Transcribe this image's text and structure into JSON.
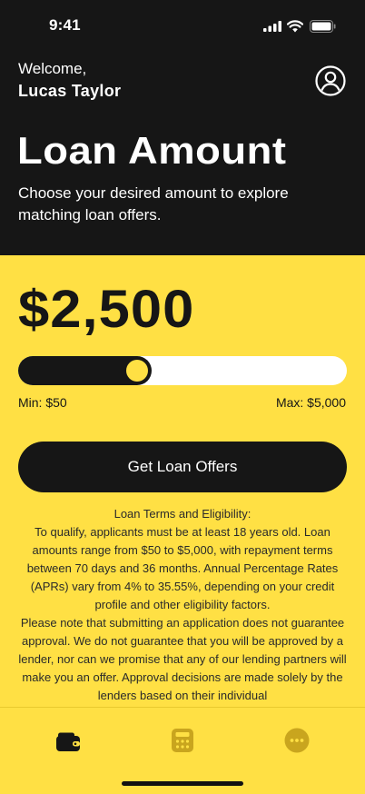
{
  "status_bar": {
    "time": "9:41"
  },
  "header": {
    "greeting": "Welcome,",
    "user_name": "Lucas Taylor",
    "title": "Loan Amount",
    "subtitle": "Choose your desired amount to explore matching loan offers."
  },
  "loan": {
    "amount": "$2,500",
    "min_label": "Min: $50",
    "max_label": "Max: $5,000",
    "slider_fraction": 0.4,
    "cta_label": "Get Loan Offers"
  },
  "terms": {
    "heading": "Loan Terms and Eligibility:",
    "paragraph_1": "To qualify, applicants must be at least 18 years old. Loan amounts range from $50 to $5,000, with repayment terms between 70 days and 36 months. Annual Percentage Rates (APRs) vary from 4% to 35.55%, depending on your credit profile and other eligibility factors.",
    "paragraph_2": "Please note that submitting an application does not guarantee approval. We do not guarantee that you will be approved by a lender, nor can we promise that any of our lending partners will make you an offer. Approval decisions are made solely by the lenders based on their individual"
  },
  "tabs": [
    {
      "icon": "wallet-icon",
      "active": true
    },
    {
      "icon": "calculator-icon",
      "active": false
    },
    {
      "icon": "more-icon",
      "active": false
    }
  ],
  "colors": {
    "accent": "#FFE044",
    "dark": "#161616",
    "inactive_icon": "#C9A51E"
  }
}
